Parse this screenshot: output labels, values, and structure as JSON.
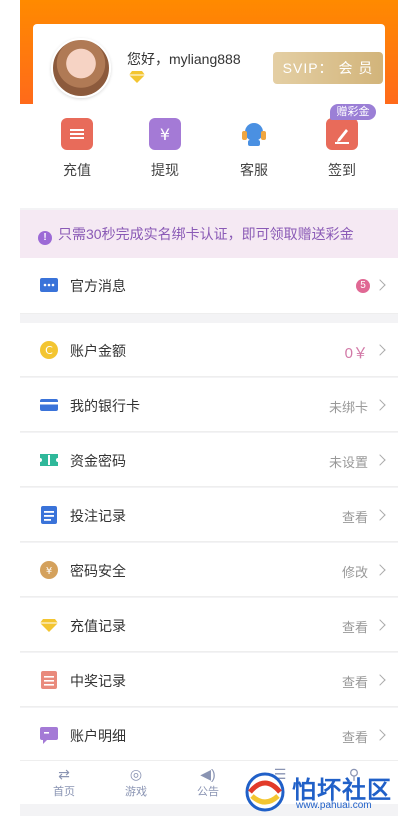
{
  "profile": {
    "greeting": "您好，myliang888",
    "svip_label": "SVIP： 会 员"
  },
  "quick_actions": [
    {
      "label": "充值",
      "icon": "ticket-icon",
      "color": "#e86b5a"
    },
    {
      "label": "提现",
      "icon": "yen-card-icon",
      "color": "#a47ad6"
    },
    {
      "label": "客服",
      "icon": "headset-icon",
      "color": "#4a90e2"
    },
    {
      "label": "签到",
      "icon": "pen-note-icon",
      "color": "#e86b5a"
    }
  ],
  "gift_badge": "赠彩金",
  "notice": {
    "text": "只需30秒完成实名绑卡认证，即可领取赠送彩金"
  },
  "messages": {
    "label": "官方消息",
    "count": "5"
  },
  "menu": [
    {
      "label": "账户金额",
      "value": "0￥",
      "icon": "coin-icon"
    },
    {
      "label": "我的银行卡",
      "value": "未绑卡",
      "icon": "bank-card-icon"
    },
    {
      "label": "资金密码",
      "value": "未设置",
      "icon": "ticket-icon"
    },
    {
      "label": "投注记录",
      "value": "查看",
      "icon": "document-icon"
    },
    {
      "label": "密码安全",
      "value": "修改",
      "icon": "yen-coin-icon"
    },
    {
      "label": "充值记录",
      "value": "查看",
      "icon": "diamond-icon"
    },
    {
      "label": "中奖记录",
      "value": "查看",
      "icon": "list-icon"
    },
    {
      "label": "账户明细",
      "value": "查看",
      "icon": "chat-icon"
    }
  ],
  "tabs": [
    {
      "label": "首页",
      "icon": "shuffle-icon"
    },
    {
      "label": "游戏",
      "icon": "ball-icon"
    },
    {
      "label": "公告",
      "icon": "speaker-icon"
    },
    {
      "label": "",
      "icon": "menu-icon"
    },
    {
      "label": "",
      "icon": "user-icon"
    }
  ],
  "watermark": {
    "text": "怕坏社区",
    "url": "www.pahuai.com"
  }
}
